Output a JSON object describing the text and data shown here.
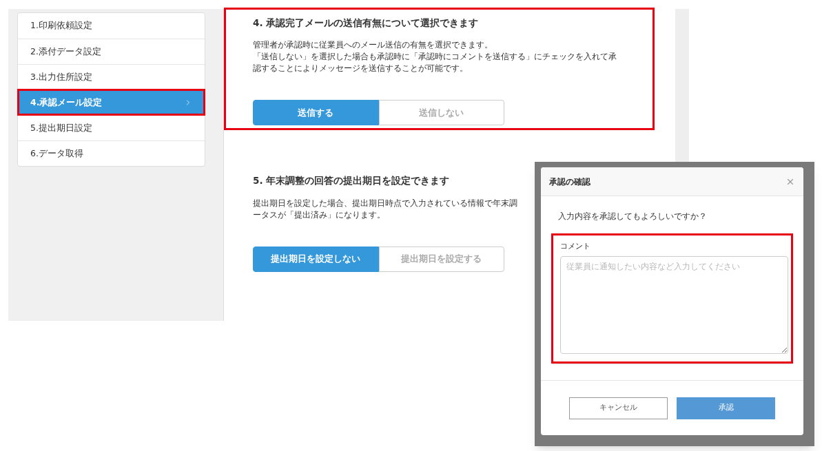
{
  "sidebar": {
    "items": [
      {
        "label": "1.印刷依頼設定",
        "selected": false,
        "highlighted": false
      },
      {
        "label": "2.添付データ設定",
        "selected": false,
        "highlighted": false
      },
      {
        "label": "3.出力住所設定",
        "selected": false,
        "highlighted": false
      },
      {
        "label": "4.承認メール設定",
        "selected": true,
        "highlighted": true
      },
      {
        "label": "5.提出期日設定",
        "selected": false,
        "highlighted": false
      },
      {
        "label": "6.データ取得",
        "selected": false,
        "highlighted": false
      }
    ]
  },
  "sections": [
    {
      "title": "4. 承認完了メールの送信有無について選択できます",
      "highlighted": true,
      "description": [
        "管理者が承認時に従業員へのメール送信の有無を選択できます。",
        "「送信しない」を選択した場合も承認時に「承認時にコメントを送信する」にチェックを入れて承",
        "認することによりメッセージを送信することが可能です。"
      ],
      "options": [
        {
          "label": "送信する",
          "selected": true
        },
        {
          "label": "送信しない",
          "selected": false
        }
      ]
    },
    {
      "title": "5. 年末調整の回答の提出期日を設定できます",
      "highlighted": false,
      "description": [
        "提出期日を設定した場合、提出期日時点で入力されている情報で年末調",
        "ータスが「提出済み」になります。"
      ],
      "options": [
        {
          "label": "提出期日を設定しない",
          "selected": true
        },
        {
          "label": "提出期日を設定する",
          "selected": false
        }
      ]
    }
  ],
  "dialog": {
    "title": "承認の確認",
    "message": "入力内容を承認してもよろしいですか？",
    "comment": {
      "label": "コメント",
      "placeholder": "従業員に通知したい内容など入力してください",
      "highlighted": true
    },
    "buttons": [
      {
        "label": "キャンセル",
        "kind": "secondary"
      },
      {
        "label": "承認",
        "kind": "primary"
      }
    ]
  }
}
